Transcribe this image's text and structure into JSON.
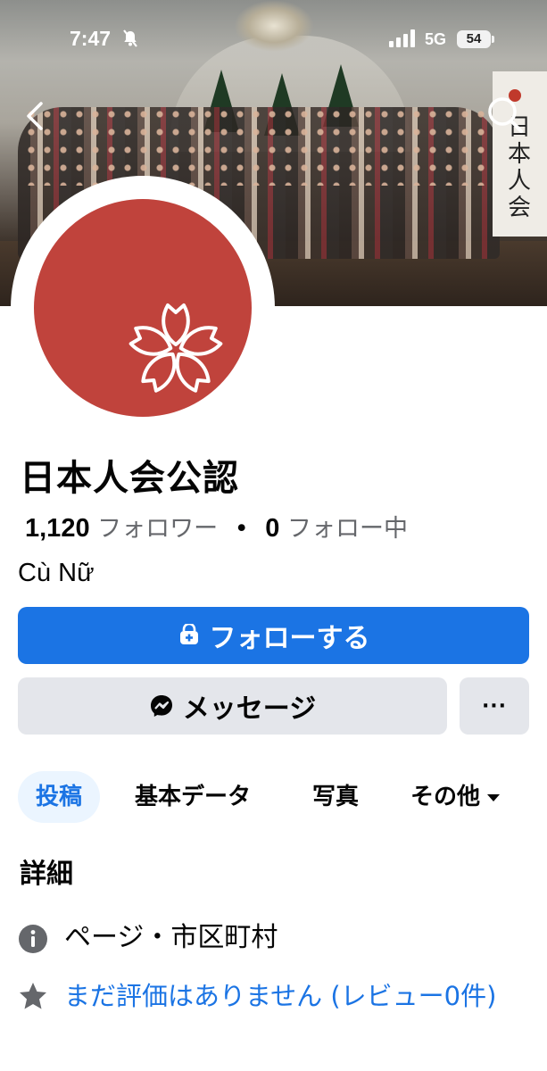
{
  "status_bar": {
    "time": "7:47",
    "network": "5G",
    "battery": "54"
  },
  "cover": {
    "banner_text": "日本人会"
  },
  "profile": {
    "name": "日本人会公認",
    "followers_count": "1,120",
    "followers_label": "フォロワー",
    "separator": "•",
    "following_count": "0",
    "following_label": "フォロー中",
    "subtitle": "Cù Nữ"
  },
  "actions": {
    "follow_label": "フォローする",
    "message_label": "メッセージ",
    "more_label": "···"
  },
  "tabs": [
    {
      "label": "投稿",
      "active": true
    },
    {
      "label": "基本データ",
      "active": false
    },
    {
      "label": "写真",
      "active": false
    },
    {
      "label": "その他",
      "active": false
    }
  ],
  "details": {
    "title": "詳細",
    "category": "ページ・市区町村",
    "reviews": "まだ評価はありません (レビュー0件)"
  },
  "icons": [
    "bell-muted-icon",
    "signal-icon",
    "back-icon",
    "search-icon",
    "sakura-logo-icon",
    "follow-icon",
    "messenger-icon",
    "info-icon",
    "star-icon",
    "caret-down-icon"
  ],
  "colors": {
    "accent": "#1b74e4",
    "logo_bg": "#c0433c",
    "button_gray": "#e4e6eb",
    "tab_active_bg": "#ebf5ff"
  }
}
